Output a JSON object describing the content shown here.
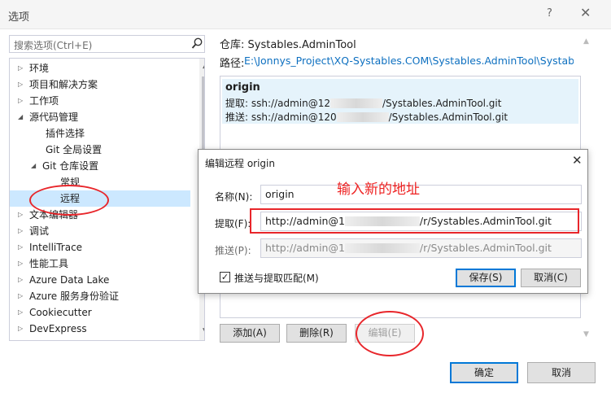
{
  "window": {
    "title": "选项",
    "help_glyph": "?",
    "close_glyph": "✕"
  },
  "search": {
    "placeholder": "搜索选项(Ctrl+E)",
    "icon": "search-icon"
  },
  "tree": {
    "items": [
      {
        "label": "环境",
        "arrow": "right",
        "level": 0
      },
      {
        "label": "项目和解决方案",
        "arrow": "right",
        "level": 0
      },
      {
        "label": "工作项",
        "arrow": "right",
        "level": 0
      },
      {
        "label": "源代码管理",
        "arrow": "down",
        "level": 0
      },
      {
        "label": "插件选择",
        "arrow": "",
        "level": 1
      },
      {
        "label": "Git 全局设置",
        "arrow": "",
        "level": 1
      },
      {
        "label": "Git 仓库设置",
        "arrow": "down",
        "level": 1
      },
      {
        "label": "常规",
        "arrow": "",
        "level": 2
      },
      {
        "label": "远程",
        "arrow": "",
        "level": 2,
        "selected": true
      },
      {
        "label": "文本编辑器",
        "arrow": "right",
        "level": 0
      },
      {
        "label": "调试",
        "arrow": "right",
        "level": 0
      },
      {
        "label": "IntelliTrace",
        "arrow": "right",
        "level": 0
      },
      {
        "label": "性能工具",
        "arrow": "right",
        "level": 0
      },
      {
        "label": "Azure Data Lake",
        "arrow": "right",
        "level": 0
      },
      {
        "label": "Azure 服务身份验证",
        "arrow": "right",
        "level": 0
      },
      {
        "label": "Cookiecutter",
        "arrow": "right",
        "level": 0
      },
      {
        "label": "DevExpress",
        "arrow": "right",
        "level": 0
      }
    ]
  },
  "right": {
    "repo_label": "仓库: Systables.AdminTool",
    "path_label": "路径:",
    "path_value": "E:\\Jonnys_Project\\XQ-Systables.COM\\Systables.AdminTool\\Systables...",
    "remote": {
      "name": "origin",
      "fetch_prefix": "提取: ssh://admin@12",
      "fetch_suffix": "/Systables.AdminTool.git",
      "push_prefix": "推送: ssh://admin@120",
      "push_suffix": "/Systables.AdminTool.git"
    },
    "buttons": {
      "add": "添加(A)",
      "remove": "删除(R)",
      "edit": "编辑(E)"
    }
  },
  "dialog": {
    "title": "编辑远程 origin",
    "name_label": "名称(N):",
    "name_value": "origin",
    "fetch_label": "提取(F):",
    "fetch_prefix": "http://admin@1",
    "fetch_suffix": "/r/Systables.AdminTool.git",
    "push_label": "推送(P):",
    "push_prefix": "http://admin@1",
    "push_suffix": "/r/Systables.AdminTool.git",
    "match_label": "推送与提取匹配(M)",
    "match_checked": true,
    "save": "保存(S)",
    "cancel": "取消(C)"
  },
  "annotation": {
    "text": "输入新的地址",
    "color": "#e8262b"
  },
  "footer": {
    "ok": "确定",
    "cancel": "取消"
  }
}
